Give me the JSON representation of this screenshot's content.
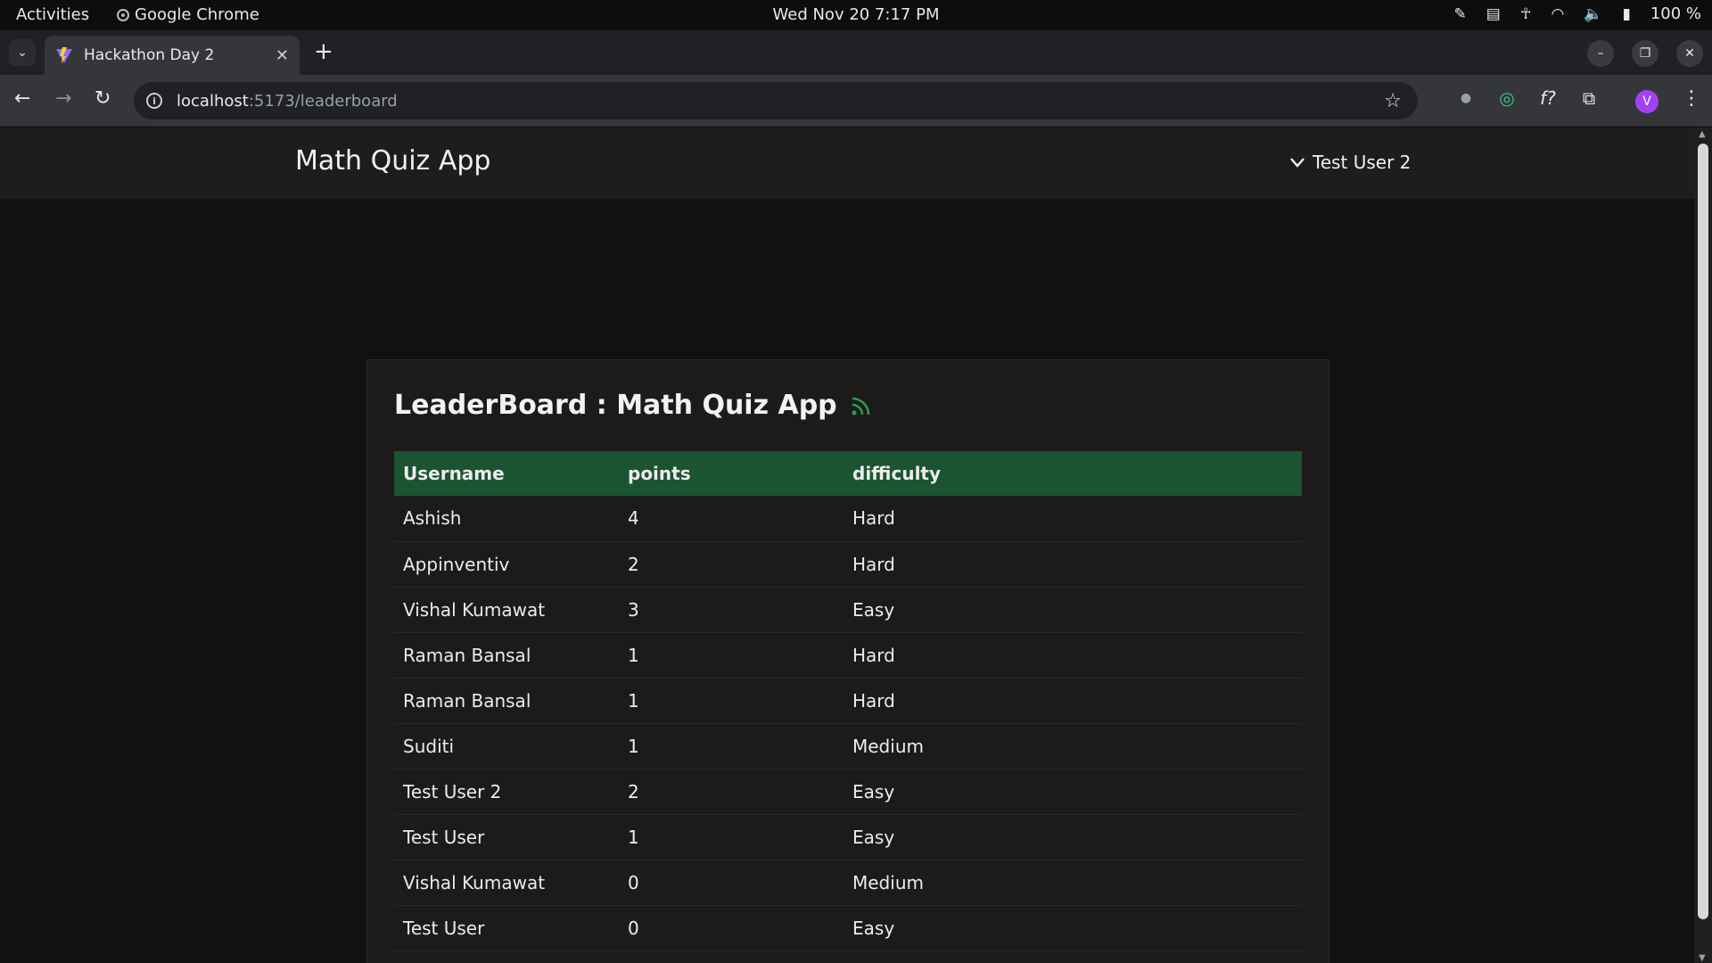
{
  "system": {
    "activities": "Activities",
    "app_name": "Google Chrome",
    "clock": "Wed Nov 20  7:17 PM",
    "battery": "100 %"
  },
  "browser": {
    "tab_title": "Hackathon Day 2",
    "url_host": "localhost",
    "url_path": ":5173/leaderboard",
    "profile_initial": "V"
  },
  "app": {
    "brand": "Math Quiz App",
    "user_menu_label": "Test User 2"
  },
  "leaderboard": {
    "title": "LeaderBoard : Math Quiz App",
    "columns": [
      "Username",
      "points",
      "difficulty"
    ],
    "rows": [
      [
        "Ashish",
        "4",
        "Hard"
      ],
      [
        "Appinventiv",
        "2",
        "Hard"
      ],
      [
        "Vishal Kumawat",
        "3",
        "Easy"
      ],
      [
        "Raman Bansal",
        "1",
        "Hard"
      ],
      [
        "Raman Bansal",
        "1",
        "Hard"
      ],
      [
        "Suditi",
        "1",
        "Medium"
      ],
      [
        "Test User 2",
        "2",
        "Easy"
      ],
      [
        "Test User",
        "1",
        "Easy"
      ],
      [
        "Vishal Kumawat",
        "0",
        "Medium"
      ],
      [
        "Test User",
        "0",
        "Easy"
      ]
    ]
  },
  "colors": {
    "header_row": "#1a5430",
    "rss_icon": "#2e9e4f",
    "profile": "#a142f4"
  }
}
